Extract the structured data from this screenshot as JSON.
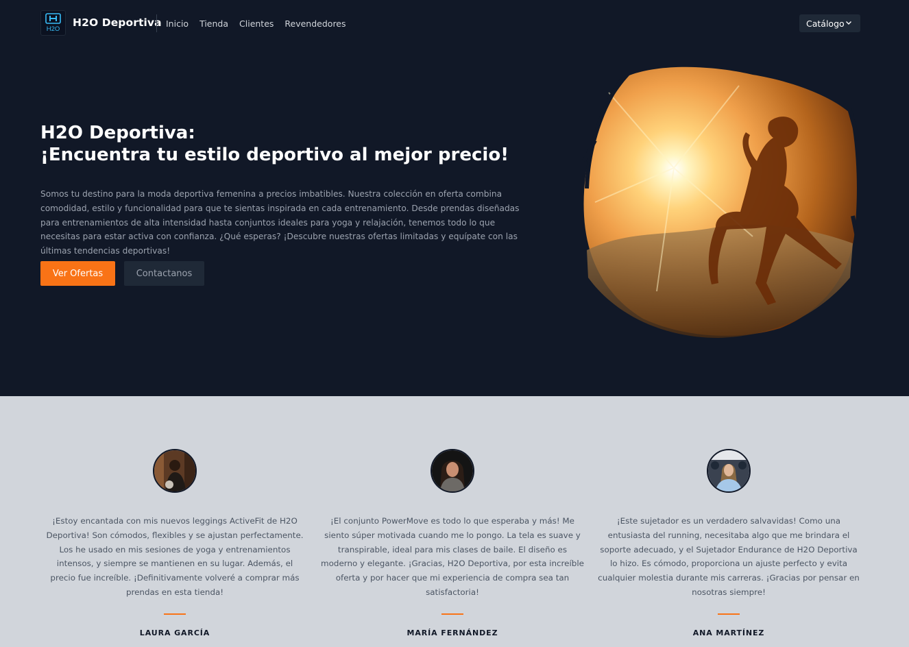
{
  "brand": {
    "logo_text": "H2O",
    "name": "H2O Deportiva"
  },
  "nav": {
    "links": [
      "Inicio",
      "Tienda",
      "Clientes",
      "Revendedores"
    ],
    "catalog_label": "Catálogo"
  },
  "hero": {
    "title_line1": "H2O Deportiva:",
    "title_line2": "¡Encuentra tu estilo deportivo al mejor precio!",
    "description": "Somos tu destino para la moda deportiva femenina a precios imbatibles. Nuestra colección en oferta combina comodidad, estilo y funcionalidad para que te sientas inspirada en cada entrenamiento. Desde prendas diseñadas para entrenamientos de alta intensidad hasta conjuntos ideales para yoga y relajación, tenemos todo lo que necesitas para estar activa con confianza. ¿Qué esperas? ¡Descubre nuestras ofertas limitadas y equípate con las últimas tendencias deportivas!",
    "primary_button": "Ver Ofertas",
    "secondary_button": "Contactanos"
  },
  "testimonials": [
    {
      "quote": "¡Estoy encantada con mis nuevos leggings ActiveFit de H2O Deportiva! Son cómodos, flexibles y se ajustan perfectamente. Los he usado en mis sesiones de yoga y entrenamientos intensos, y siempre se mantienen en su lugar. Además, el precio fue increíble. ¡Definitivamente volveré a comprar más prendas en esta tienda!",
      "author": "LAURA GARCÍA"
    },
    {
      "quote": "¡El conjunto PowerMove es todo lo que esperaba y más! Me siento súper motivada cuando me lo pongo. La tela es suave y transpirable, ideal para mis clases de baile. El diseño es moderno y elegante. ¡Gracias, H2O Deportiva, por esta increíble oferta y por hacer que mi experiencia de compra sea tan satisfactoria!",
      "author": "MARÍA FERNÁNDEZ"
    },
    {
      "quote": "¡Este sujetador es un verdadero salvavidas! Como una entusiasta del running, necesitaba algo que me brindara el soporte adecuado, y el Sujetador Endurance de H2O Deportiva lo hizo. Es cómodo, proporciona un ajuste perfecto y evita cualquier molestia durante mis carreras. ¡Gracias por pensar en nosotras siempre!",
      "author": "ANA MARTÍNEZ"
    }
  ],
  "colors": {
    "hero_bg": "#111827",
    "accent": "#f97316",
    "section_bg": "#d1d5db"
  }
}
